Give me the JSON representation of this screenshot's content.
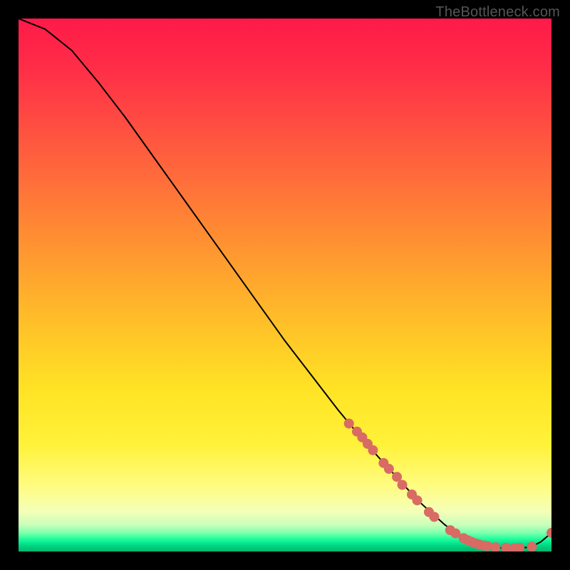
{
  "watermark": "TheBottleneck.com",
  "colors": {
    "page_bg": "#000000",
    "curve": "#000000",
    "markers": "#d86b63",
    "watermark": "#555555"
  },
  "chart_data": {
    "type": "line",
    "title": "",
    "xlabel": "",
    "ylabel": "",
    "xlim": [
      0,
      100
    ],
    "ylim": [
      0,
      100
    ],
    "grid": false,
    "legend": false,
    "series": [
      {
        "name": "bottleneck-curve",
        "x": [
          0,
          5,
          10,
          15,
          20,
          25,
          30,
          35,
          40,
          45,
          50,
          55,
          60,
          65,
          70,
          75,
          80,
          82,
          85,
          88,
          90,
          93,
          96,
          98,
          100
        ],
        "y": [
          100,
          98,
          94,
          88,
          81.5,
          74.5,
          67.5,
          60.5,
          53.5,
          46.5,
          39.5,
          33,
          26.5,
          20.5,
          15,
          9.5,
          5,
          3.5,
          2,
          1,
          0.7,
          0.6,
          0.8,
          1.8,
          3.5
        ]
      }
    ],
    "markers": [
      {
        "x": 62,
        "y": 24
      },
      {
        "x": 63.5,
        "y": 22.5
      },
      {
        "x": 64.5,
        "y": 21.4
      },
      {
        "x": 65.5,
        "y": 20.2
      },
      {
        "x": 66.5,
        "y": 19
      },
      {
        "x": 68.5,
        "y": 16.6
      },
      {
        "x": 69.5,
        "y": 15.5
      },
      {
        "x": 71,
        "y": 14
      },
      {
        "x": 72,
        "y": 12.5
      },
      {
        "x": 73.8,
        "y": 10.7
      },
      {
        "x": 74.8,
        "y": 9.6
      },
      {
        "x": 77,
        "y": 7.4
      },
      {
        "x": 78,
        "y": 6.5
      },
      {
        "x": 81,
        "y": 4
      },
      {
        "x": 82,
        "y": 3.4
      },
      {
        "x": 83.5,
        "y": 2.5
      },
      {
        "x": 84.3,
        "y": 2.1
      },
      {
        "x": 85,
        "y": 1.8
      },
      {
        "x": 85.8,
        "y": 1.5
      },
      {
        "x": 86.5,
        "y": 1.3
      },
      {
        "x": 87.3,
        "y": 1.1
      },
      {
        "x": 88,
        "y": 1
      },
      {
        "x": 89.5,
        "y": 0.8
      },
      {
        "x": 91.5,
        "y": 0.7
      },
      {
        "x": 93,
        "y": 0.6
      },
      {
        "x": 94,
        "y": 0.7
      },
      {
        "x": 96.3,
        "y": 0.9
      },
      {
        "x": 100,
        "y": 3.5
      }
    ]
  }
}
